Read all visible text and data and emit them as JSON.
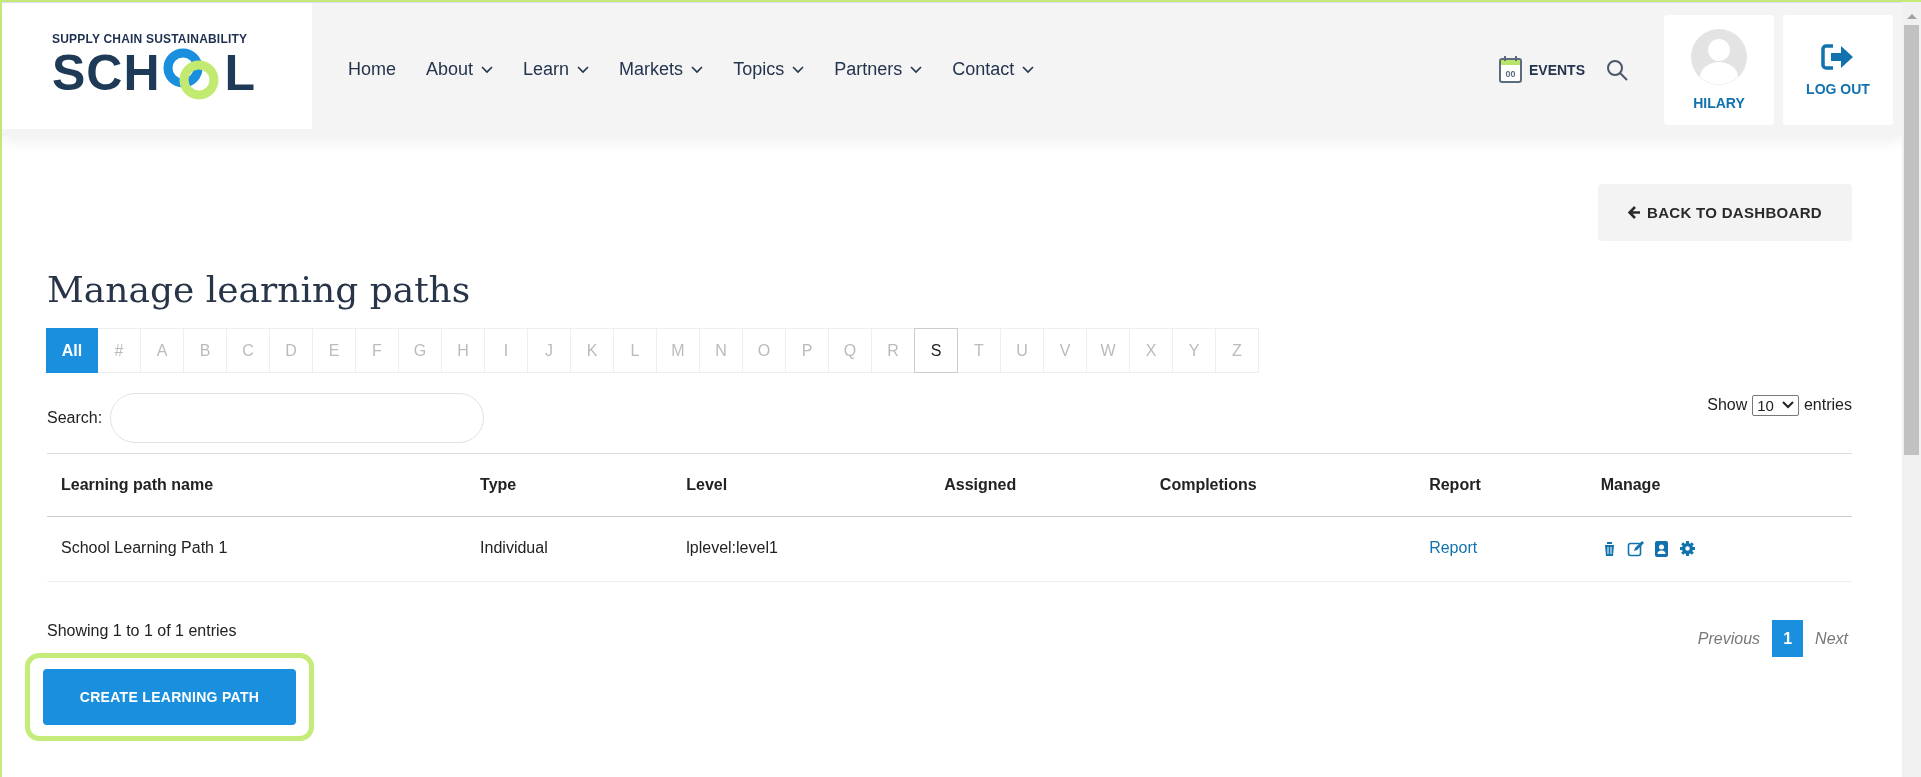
{
  "header": {
    "logo": {
      "tagline": "SUPPLY CHAIN SUSTAINABILITY",
      "word_start": "SCH",
      "word_end": "L"
    },
    "nav": [
      {
        "label": "Home",
        "has_menu": false
      },
      {
        "label": "About",
        "has_menu": true
      },
      {
        "label": "Learn",
        "has_menu": true
      },
      {
        "label": "Markets",
        "has_menu": true
      },
      {
        "label": "Topics",
        "has_menu": true
      },
      {
        "label": "Partners",
        "has_menu": true
      },
      {
        "label": "Contact",
        "has_menu": true
      }
    ],
    "events": {
      "calendar_day": "00",
      "label": "EVENTS"
    },
    "user": {
      "name": "HILARY"
    },
    "logout": {
      "label": "LOG OUT"
    }
  },
  "back_button": {
    "label": "BACK TO DASHBOARD"
  },
  "title": "Manage learning paths",
  "letter_filter": [
    {
      "label": "All",
      "selected": true,
      "enabled": true
    },
    {
      "label": "#",
      "selected": false,
      "enabled": false
    },
    {
      "label": "A",
      "selected": false,
      "enabled": false
    },
    {
      "label": "B",
      "selected": false,
      "enabled": false
    },
    {
      "label": "C",
      "selected": false,
      "enabled": false
    },
    {
      "label": "D",
      "selected": false,
      "enabled": false
    },
    {
      "label": "E",
      "selected": false,
      "enabled": false
    },
    {
      "label": "F",
      "selected": false,
      "enabled": false
    },
    {
      "label": "G",
      "selected": false,
      "enabled": false
    },
    {
      "label": "H",
      "selected": false,
      "enabled": false
    },
    {
      "label": "I",
      "selected": false,
      "enabled": false
    },
    {
      "label": "J",
      "selected": false,
      "enabled": false
    },
    {
      "label": "K",
      "selected": false,
      "enabled": false
    },
    {
      "label": "L",
      "selected": false,
      "enabled": false
    },
    {
      "label": "M",
      "selected": false,
      "enabled": false
    },
    {
      "label": "N",
      "selected": false,
      "enabled": false
    },
    {
      "label": "O",
      "selected": false,
      "enabled": false
    },
    {
      "label": "P",
      "selected": false,
      "enabled": false
    },
    {
      "label": "Q",
      "selected": false,
      "enabled": false
    },
    {
      "label": "R",
      "selected": false,
      "enabled": false
    },
    {
      "label": "S",
      "selected": false,
      "enabled": true
    },
    {
      "label": "T",
      "selected": false,
      "enabled": false
    },
    {
      "label": "U",
      "selected": false,
      "enabled": false
    },
    {
      "label": "V",
      "selected": false,
      "enabled": false
    },
    {
      "label": "W",
      "selected": false,
      "enabled": false
    },
    {
      "label": "X",
      "selected": false,
      "enabled": false
    },
    {
      "label": "Y",
      "selected": false,
      "enabled": false
    },
    {
      "label": "Z",
      "selected": false,
      "enabled": false
    }
  ],
  "search": {
    "label": "Search:"
  },
  "page_length": {
    "label_before": "Show",
    "value": "10",
    "label_after": "entries"
  },
  "table": {
    "columns": [
      "Learning path name",
      "Type",
      "Level",
      "Assigned",
      "Completions",
      "Report",
      "Manage"
    ],
    "rows": [
      {
        "name": "School Learning Path 1",
        "type": "Individual",
        "level": "lplevel:level1",
        "report": "Report",
        "actions": [
          {
            "kind": "delete"
          },
          {
            "kind": "edit"
          },
          {
            "kind": "contacts"
          },
          {
            "kind": "settings"
          }
        ]
      }
    ]
  },
  "info": "Showing 1 to 1 of 1 entries",
  "pagination": [
    {
      "label": "Previous",
      "kind": "prev",
      "disabled": true,
      "selected": false
    },
    {
      "label": "1",
      "kind": "page",
      "disabled": false,
      "selected": true
    },
    {
      "label": "Next",
      "kind": "next",
      "disabled": true,
      "selected": false
    }
  ],
  "create_button": {
    "label": "CREATE LEARNING PATH",
    "highlighted": true
  }
}
